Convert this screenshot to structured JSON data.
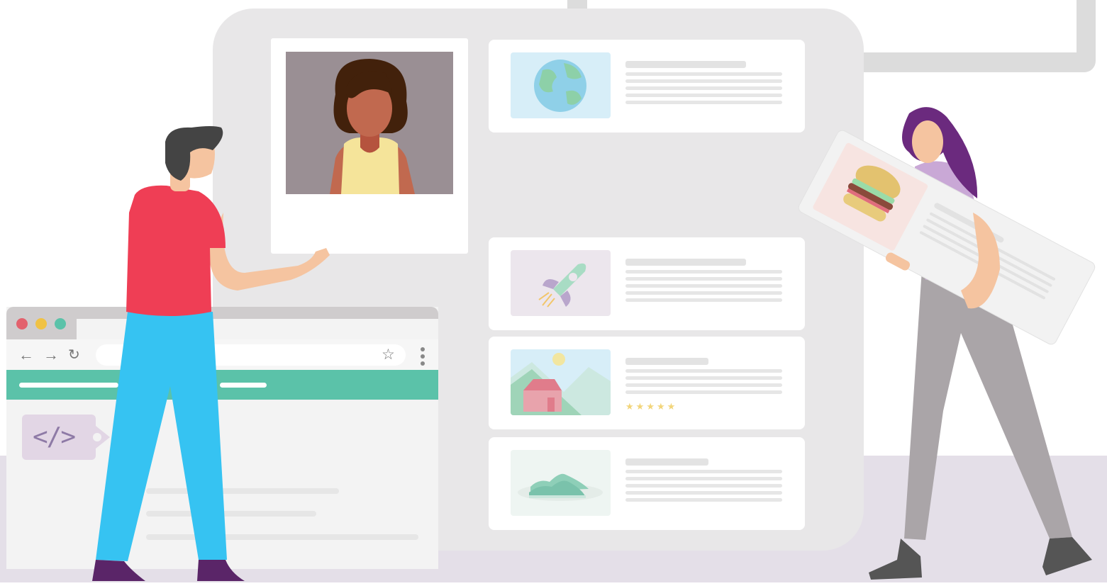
{
  "illustration": {
    "colors": {
      "board": "#e8e7e8",
      "card": "#ffffff",
      "accent_green": "#5bc2a9",
      "floor": "#e4dfe8",
      "man_shirt": "#ef3e55",
      "man_pants": "#36c3f2",
      "woman_hair": "#6b2a7e",
      "woman_pants": "#aaa5a8",
      "shoes": "#5a2568"
    },
    "browser": {
      "window_dots": [
        "#e3626d",
        "#f0c244",
        "#5bc2a9"
      ],
      "back_icon": "arrow-left",
      "forward_icon": "arrow-right",
      "reload_icon": "reload",
      "bookmark_icon": "star",
      "menu_icon": "kebab-menu",
      "tag_icon": "code-tag"
    },
    "code_tag_label": "</>",
    "result_cards": [
      {
        "thumbnail": "globe-icon",
        "rating_stars": 0
      },
      {
        "thumbnail": "rocket-icon",
        "rating_stars": 0
      },
      {
        "thumbnail": "landscape-house-icon",
        "rating_stars": 5
      },
      {
        "thumbnail": "sneakers-icon",
        "rating_stars": 0
      }
    ],
    "held_card_thumbnail": "burger-icon",
    "portrait": "woman-portrait"
  }
}
